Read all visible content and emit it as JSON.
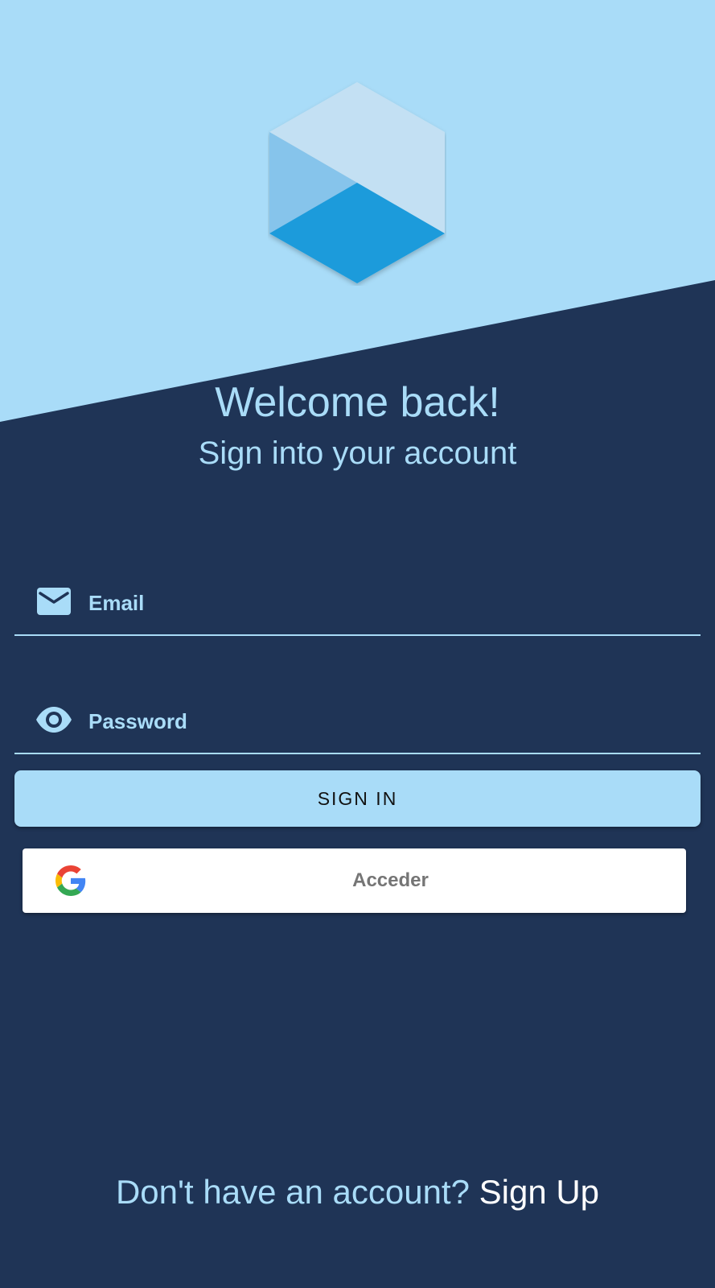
{
  "colors": {
    "background": "#1f3456",
    "accent_light": "#a9dcf8",
    "button_text": "#111111",
    "google_button_bg": "#ffffff",
    "google_text": "#757575",
    "link": "#ffffff"
  },
  "header": {
    "logo_icon": "hexagon-cube-logo-icon",
    "title": "Welcome back!",
    "subtitle": "Sign into your account"
  },
  "form": {
    "email": {
      "icon": "mail-icon",
      "placeholder": "Email",
      "value": ""
    },
    "password": {
      "icon": "eye-icon",
      "placeholder": "Password",
      "value": ""
    },
    "signin_label": "SIGN IN"
  },
  "google_button": {
    "icon": "google-g-icon",
    "label": "Acceder"
  },
  "footer": {
    "prompt": "Don't have an account?",
    "link_label": "Sign Up"
  }
}
